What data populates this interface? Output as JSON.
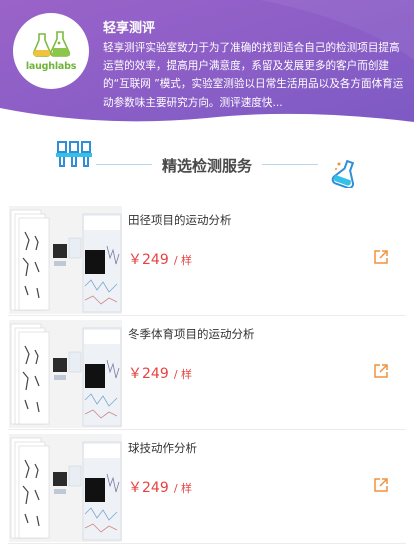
{
  "header": {
    "logo_text": "laughlabs",
    "title": "轻享测评",
    "description": "轻享测评实验室致力于为了准确的找到适合自己的检测项目提高运营的效率，提高用户满意度，系留及发展更多的客户而创建的“互联网 ”模式，实验室测验以日常生活用品以及各方面体育运动参数味主要研究方向。测评速度快..."
  },
  "section": {
    "title": "精选检测服务"
  },
  "products": [
    {
      "title": "田径项目的运动分析",
      "price": "￥249",
      "unit": "/ 样"
    },
    {
      "title": "冬季体育项目的运动分析",
      "price": "￥249",
      "unit": "/ 样"
    },
    {
      "title": "球技动作分析",
      "price": "￥249",
      "unit": "/ 样"
    }
  ],
  "colors": {
    "header_purple": "#8c5dc6",
    "price_red": "#e64340",
    "share_orange": "#f0923b",
    "icon_blue": "#2e8fd8"
  },
  "icons": {
    "section_left": "lab-tubes-icon",
    "section_right": "flask-icon",
    "share": "external-link-icon"
  }
}
